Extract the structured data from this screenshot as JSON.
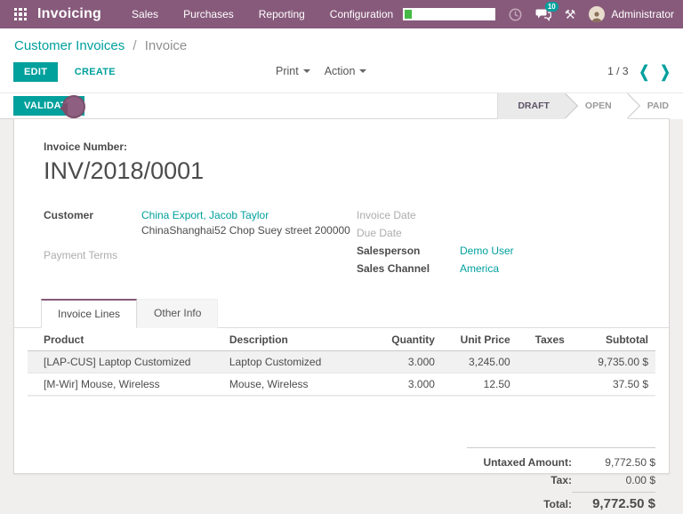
{
  "colors": {
    "brand_purple": "#875A7B",
    "accent_teal": "#00A09D",
    "timer_green": "#44b944",
    "status_active_bg": "#eaeaea",
    "click_indicator": "#8e5f80"
  },
  "navbar": {
    "app_name": "Invoicing",
    "menus": [
      "Sales",
      "Purchases",
      "Reporting",
      "Configuration"
    ],
    "badge_count": "10",
    "tools_glyph": "⚒",
    "user": "Administrator"
  },
  "breadcrumb": {
    "parent": "Customer Invoices",
    "separator": "/",
    "current": "Invoice"
  },
  "control_panel": {
    "edit": "EDIT",
    "create": "CREATE",
    "print": "Print",
    "action": "Action",
    "pager_text": "1 / 3",
    "pager_prev": "❮",
    "pager_next": "❯"
  },
  "statusbar": {
    "validate": "VALIDATE",
    "steps": [
      {
        "label": "DRAFT"
      },
      {
        "label": "OPEN"
      },
      {
        "label": "PAID"
      }
    ]
  },
  "invoice": {
    "number_label": "Invoice Number:",
    "number": "INV/2018/0001",
    "customer_label": "Customer",
    "customer_value": "China Export, Jacob Taylor",
    "customer_address": "ChinaShanghai52 Chop Suey street 200000",
    "payment_terms_label": "Payment Terms",
    "invoice_date_label": "Invoice Date",
    "due_date_label": "Due Date",
    "salesperson_label": "Salesperson",
    "salesperson_value": "Demo User",
    "sales_channel_label": "Sales Channel",
    "sales_channel_value": "America",
    "tabs": [
      "Invoice Lines",
      "Other Info"
    ],
    "table_headers": {
      "product": "Product",
      "description": "Description",
      "quantity": "Quantity",
      "unit_price": "Unit Price",
      "taxes": "Taxes",
      "subtotal": "Subtotal"
    },
    "lines": [
      {
        "product": "[LAP-CUS] Laptop Customized",
        "description": "Laptop Customized",
        "quantity": "3.000",
        "unit_price": "3,245.00",
        "taxes": "",
        "subtotal": "9,735.00 $"
      },
      {
        "product": "[M-Wir] Mouse, Wireless",
        "description": "Mouse, Wireless",
        "quantity": "3.000",
        "unit_price": "12.50",
        "taxes": "",
        "subtotal": "37.50 $"
      }
    ],
    "totals": {
      "untaxed_label": "Untaxed Amount:",
      "untaxed_value": "9,772.50 $",
      "tax_label": "Tax:",
      "tax_value": "0.00 $",
      "total_label": "Total:",
      "total_value": "9,772.50 $"
    }
  }
}
